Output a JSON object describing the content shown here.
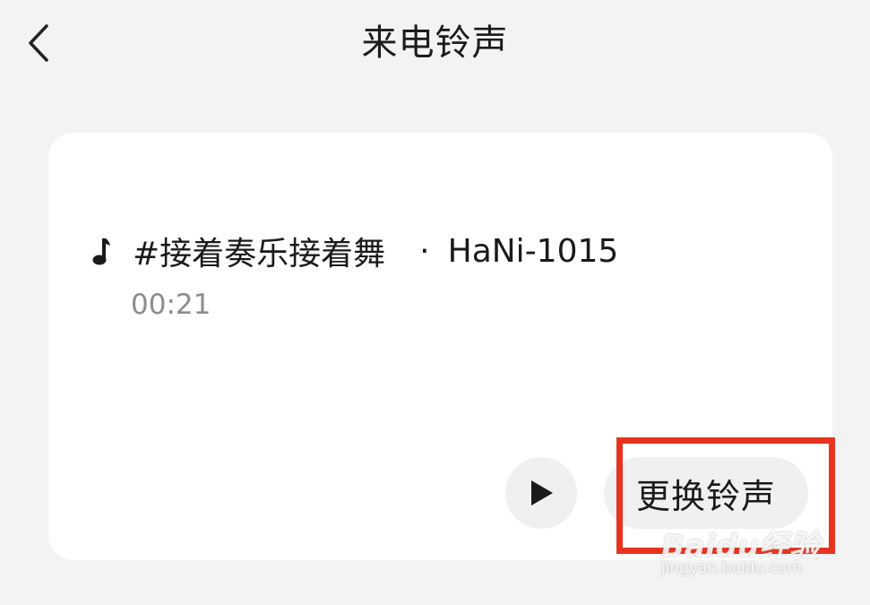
{
  "header": {
    "title": "来电铃声",
    "back_icon": "chevron-left-icon"
  },
  "ringtone": {
    "music_icon": "music-note-icon",
    "title": "#接着奏乐接着舞",
    "separator": "·",
    "artist": "HaNi-1015",
    "duration": "00:21"
  },
  "actions": {
    "play_icon": "play-icon",
    "change_label": "更换铃声"
  },
  "overlay": {
    "highlight_color": "#e8341f"
  },
  "watermark": {
    "brand": "Baidu经验",
    "url": "jingyan.baidu.com"
  }
}
